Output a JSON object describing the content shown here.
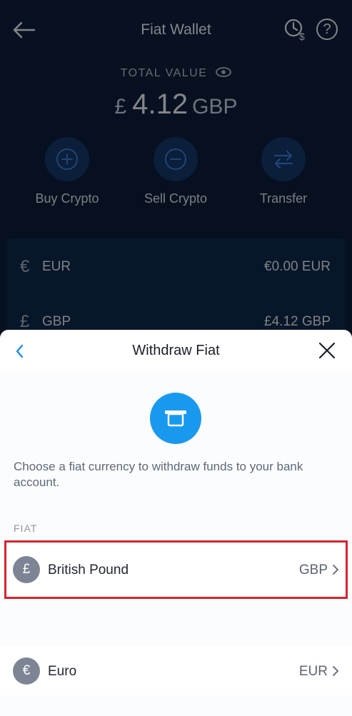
{
  "wallet": {
    "title": "Fiat Wallet",
    "total_label": "TOTAL VALUE",
    "total_symbol": "£",
    "total_amount": "4.12",
    "total_currency": "GBP",
    "actions": [
      {
        "label": "Buy Crypto",
        "icon": "plus-circle-icon"
      },
      {
        "label": "Sell Crypto",
        "icon": "minus-circle-icon"
      },
      {
        "label": "Transfer",
        "icon": "transfer-arrows-icon"
      }
    ],
    "fiat_rows": [
      {
        "symbol": "€",
        "code": "EUR",
        "balance": "€0.00 EUR"
      },
      {
        "symbol": "£",
        "code": "GBP",
        "balance": "£4.12 GBP"
      }
    ]
  },
  "sheet": {
    "title": "Withdraw Fiat",
    "description": "Choose a fiat currency to withdraw funds to your bank account.",
    "section_label": "FIAT",
    "currencies": [
      {
        "symbol": "£",
        "name": "British Pound",
        "code": "GBP"
      },
      {
        "symbol": "€",
        "name": "Euro",
        "code": "EUR"
      }
    ]
  },
  "colors": {
    "accent": "#1999ee",
    "highlight": "#d6252f",
    "sheet_bg": "#fbfcfd",
    "wallet_bg": "#0d1f3c"
  }
}
